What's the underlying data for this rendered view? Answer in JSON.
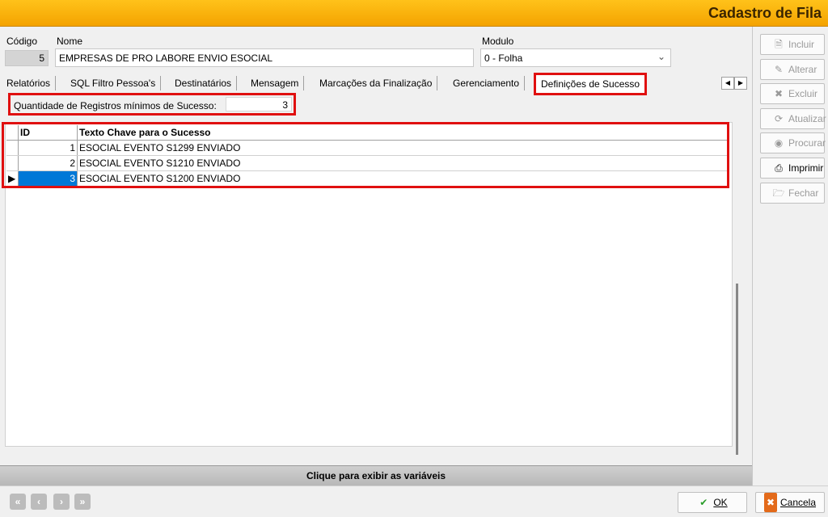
{
  "window": {
    "title": "Cadastro de Fila"
  },
  "form": {
    "codigo_label": "Código",
    "codigo_value": "5",
    "nome_label": "Nome",
    "nome_value": "EMPRESAS DE PRO LABORE ENVIO ESOCIAL",
    "modulo_label": "Modulo",
    "modulo_value": "0 - Folha"
  },
  "tabs": [
    {
      "label": "Relatórios"
    },
    {
      "label": "SQL Filtro Pessoa's"
    },
    {
      "label": "Destinatários"
    },
    {
      "label": "Mensagem"
    },
    {
      "label": "Marcações da Finalização"
    },
    {
      "label": "Gerenciamento"
    },
    {
      "label": "Definições de Sucesso"
    }
  ],
  "qty": {
    "label": "Quantidade de Registros mínimos de Sucesso:",
    "value": "3"
  },
  "grid": {
    "headers": {
      "id": "ID",
      "text": "Texto Chave para o Sucesso"
    },
    "rows": [
      {
        "id": "1",
        "text": "ESOCIAL EVENTO S1299 ENVIADO"
      },
      {
        "id": "2",
        "text": "ESOCIAL EVENTO S1210 ENVIADO"
      },
      {
        "id": "3",
        "text": "ESOCIAL EVENTO S1200 ENVIADO"
      }
    ]
  },
  "variables_bar": "Clique para exibir as variáveis",
  "side_buttons": [
    {
      "label": "Incluir",
      "icon": "document-icon",
      "enabled": false
    },
    {
      "label": "Alterar",
      "icon": "edit-icon",
      "enabled": false
    },
    {
      "label": "Excluir",
      "icon": "delete-icon",
      "enabled": false
    },
    {
      "label": "Atualizar",
      "icon": "refresh-icon",
      "enabled": false
    },
    {
      "label": "Procurar",
      "icon": "binoculars-icon",
      "enabled": false
    },
    {
      "label": "Imprimir",
      "icon": "printer-icon",
      "enabled": true
    },
    {
      "label": "Fechar",
      "icon": "close-folder-icon",
      "enabled": false
    }
  ],
  "ok_label": "OK",
  "cancel_label": "Cancela"
}
